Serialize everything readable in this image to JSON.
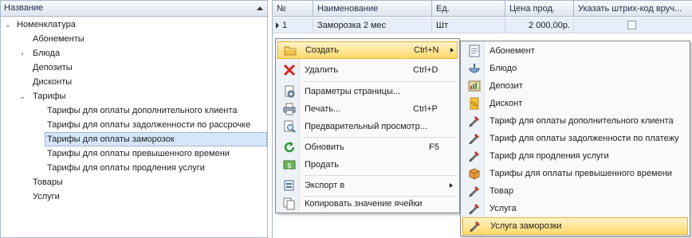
{
  "tree": {
    "header": "Название",
    "items": [
      {
        "label": "Номенклатура"
      },
      {
        "label": "Абонементы"
      },
      {
        "label": "Блюда"
      },
      {
        "label": "Депозиты"
      },
      {
        "label": "Дисконты"
      },
      {
        "label": "Тарифы"
      },
      {
        "label": "Тарифы для оплаты дополнительного клиента"
      },
      {
        "label": "Тарифы для оплаты задолженности по рассрочке"
      },
      {
        "label": "Тарифы для оплаты заморозок"
      },
      {
        "label": "Тарифы для оплаты превышенного времени"
      },
      {
        "label": "Тарифы для оплаты продления услуги"
      },
      {
        "label": "Товары"
      },
      {
        "label": "Услуги"
      }
    ]
  },
  "grid": {
    "columns": [
      "№",
      "Наименование",
      "Ед.",
      "Цена прод.",
      "Указать штрих-код вруч..."
    ],
    "rows": [
      {
        "num": "1",
        "name": "Заморозка 2 мес",
        "unit": "Шт",
        "price": "2 000,00р.",
        "barcode_checked": false
      }
    ]
  },
  "context_menu": {
    "items": [
      {
        "label": "Создать",
        "shortcut": "Ctrl+N",
        "icon": "folder-create-icon"
      },
      {
        "label": "Удалить",
        "shortcut": "Ctrl+D",
        "icon": "delete-x-icon"
      },
      {
        "label": "Параметры страницы...",
        "shortcut": "",
        "icon": "page-setup-icon"
      },
      {
        "label": "Печать...",
        "shortcut": "Ctrl+P",
        "icon": "print-icon"
      },
      {
        "label": "Предварительный просмотр...",
        "shortcut": "",
        "icon": "preview-icon"
      },
      {
        "label": "Обновить",
        "shortcut": "F5",
        "icon": "refresh-icon"
      },
      {
        "label": "Продать",
        "shortcut": "",
        "icon": "sell-icon"
      },
      {
        "label": "Экспорт в",
        "shortcut": "",
        "icon": "export-icon"
      },
      {
        "label": "Копировать значение ячейки",
        "shortcut": "",
        "icon": "copy-cell-icon"
      }
    ]
  },
  "submenu": {
    "items": [
      {
        "label": "Абонемент",
        "icon": "subscription-icon"
      },
      {
        "label": "Блюдо",
        "icon": "dish-icon"
      },
      {
        "label": "Депозит",
        "icon": "deposit-icon"
      },
      {
        "label": "Дисконт",
        "icon": "discount-icon"
      },
      {
        "label": "Тариф для оплаты дополнительного клиента",
        "icon": "tariff-icon"
      },
      {
        "label": "Тариф для оплаты задолженности по платежу",
        "icon": "tariff-icon"
      },
      {
        "label": "Тариф для продления услуги",
        "icon": "tariff-icon"
      },
      {
        "label": "Тарифы для оплаты превышенного времени",
        "icon": "box-icon"
      },
      {
        "label": "Товар",
        "icon": "tariff-icon"
      },
      {
        "label": "Услуга",
        "icon": "tariff-icon"
      },
      {
        "label": "Услуга заморозки",
        "icon": "tariff-icon"
      }
    ]
  },
  "colors": {
    "highlight": "#ffd96b",
    "selection": "#d6e6fa",
    "header_bg": "#dfe6ef"
  }
}
